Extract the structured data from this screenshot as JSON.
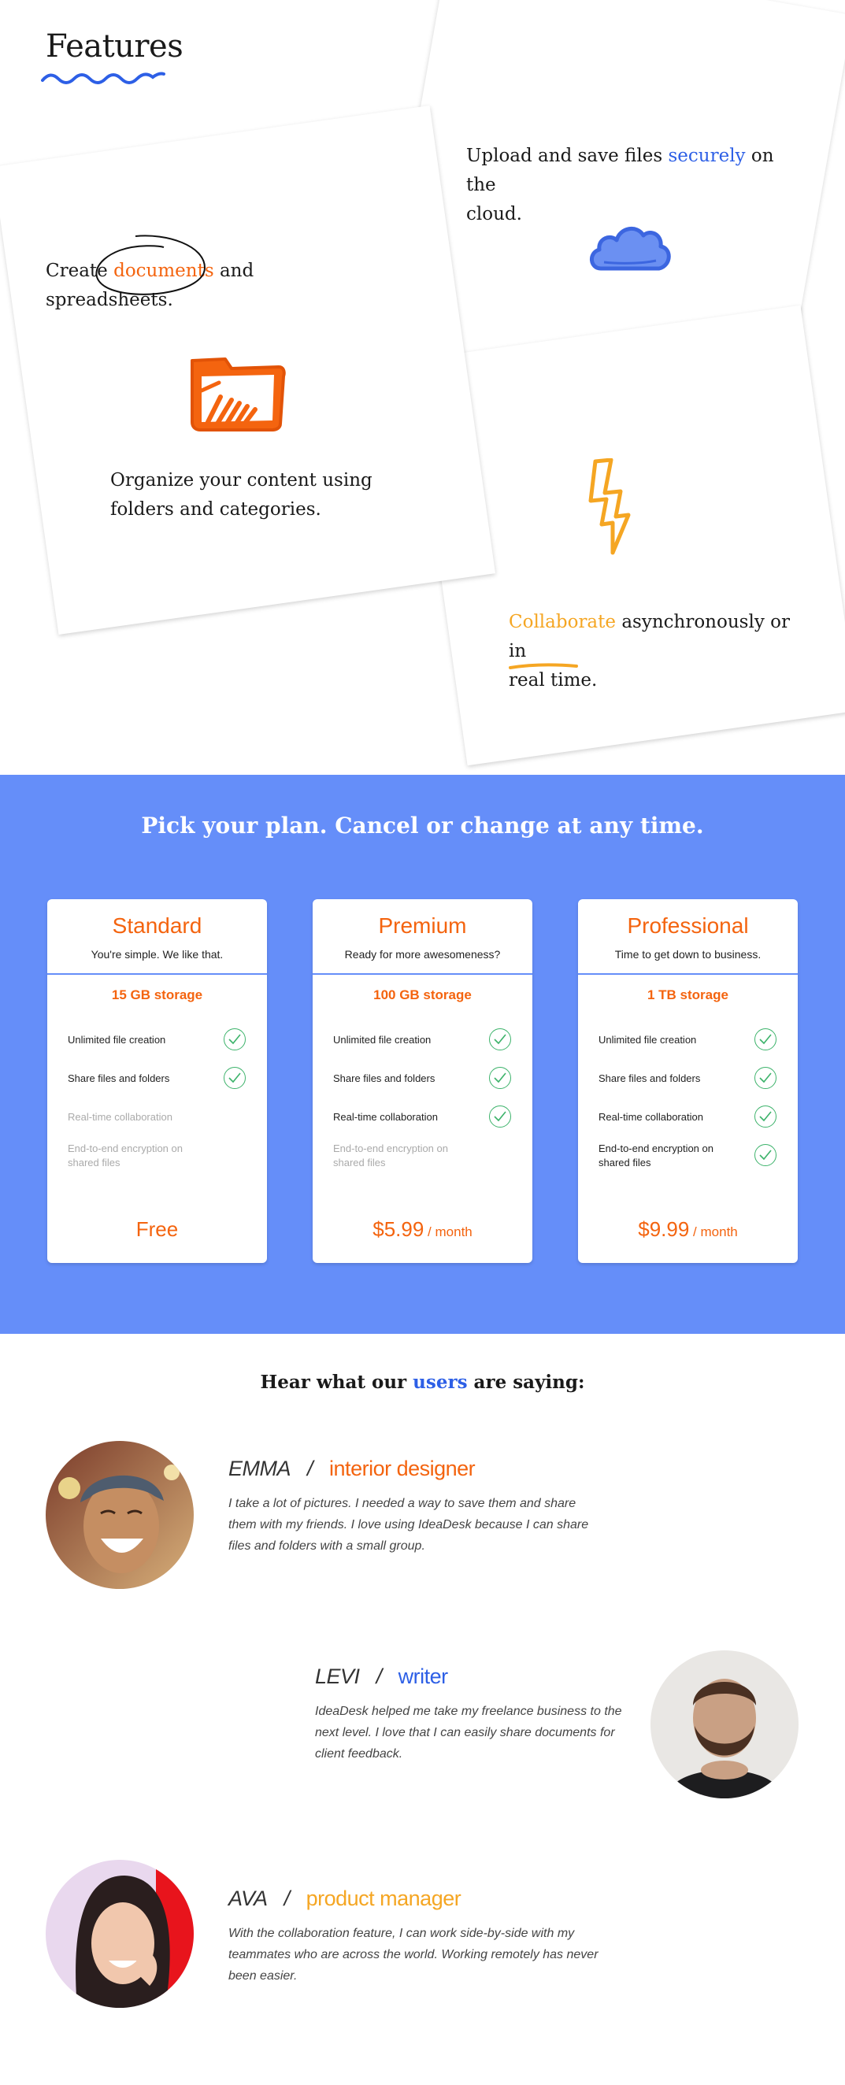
{
  "features": {
    "title": "Features",
    "card_a": {
      "line1_pre": "Create ",
      "line1_highlight": "documents",
      "line1_post": " and spreadsheets.",
      "line2": "Organize your content using",
      "line3": "folders and categories."
    },
    "card_b": {
      "line1_pre": "Upload and save files ",
      "line1_highlight": "securely",
      "line1_post": " on the",
      "line2": "cloud."
    },
    "card_c": {
      "line1_highlight": "Collaborate",
      "line1_post": " asynchronously or in",
      "line2": "real time."
    },
    "icons": [
      "folder-icon",
      "cloud-icon",
      "lightning-icon"
    ],
    "colors": {
      "orange": "#f4640f",
      "blue": "#2d5fe6",
      "amber": "#f5a623"
    }
  },
  "pricing": {
    "title": "Pick your plan. Cancel or change at any time.",
    "background": "#658ef9",
    "plans": [
      {
        "name": "Standard",
        "tagline": "You're simple. We like that.",
        "storage": "15 GB storage",
        "features": [
          {
            "label": "Unlimited file creation",
            "included": true
          },
          {
            "label": "Share files and folders",
            "included": true
          },
          {
            "label": "Real-time collaboration",
            "included": false
          },
          {
            "label": "End-to-end encryption on shared files",
            "included": false
          }
        ],
        "price": "Free",
        "period": ""
      },
      {
        "name": "Premium",
        "tagline": "Ready for more awesomeness?",
        "storage": "100 GB storage",
        "features": [
          {
            "label": "Unlimited file creation",
            "included": true
          },
          {
            "label": "Share files and folders",
            "included": true
          },
          {
            "label": "Real-time collaboration",
            "included": true
          },
          {
            "label": "End-to-end encryption on shared files",
            "included": false
          }
        ],
        "price": "$5.99",
        "period": " / month"
      },
      {
        "name": "Professional",
        "tagline": "Time to get down to business.",
        "storage": "1 TB storage",
        "features": [
          {
            "label": "Unlimited file creation",
            "included": true
          },
          {
            "label": "Share files and folders",
            "included": true
          },
          {
            "label": "Real-time collaboration",
            "included": true
          },
          {
            "label": "End-to-end encryption on shared files",
            "included": true
          }
        ],
        "price": "$9.99",
        "period": " / month"
      }
    ]
  },
  "testimonials": {
    "heading_pre": "Hear what our ",
    "heading_highlight": "users",
    "heading_post": " are saying:",
    "items": [
      {
        "name": "EMMA",
        "separator": "/",
        "role": "interior designer",
        "role_color": "#f4640f",
        "quote": "I take a lot of pictures. I needed a way to save them and share them with my friends. I love using IdeaDesk because I can share files and folders with a small group."
      },
      {
        "name": "LEVI",
        "separator": "/",
        "role": "writer",
        "role_color": "#2d5fe6",
        "quote": "IdeaDesk helped me take my freelance business to the next level. I love that I can easily share documents for client feedback."
      },
      {
        "name": "AVA",
        "separator": "/",
        "role": "product manager",
        "role_color": "#f5a623",
        "quote": "With the collaboration feature, I can work side-by-side with my teammates who are across the world. Working remotely has never been easier."
      }
    ]
  }
}
